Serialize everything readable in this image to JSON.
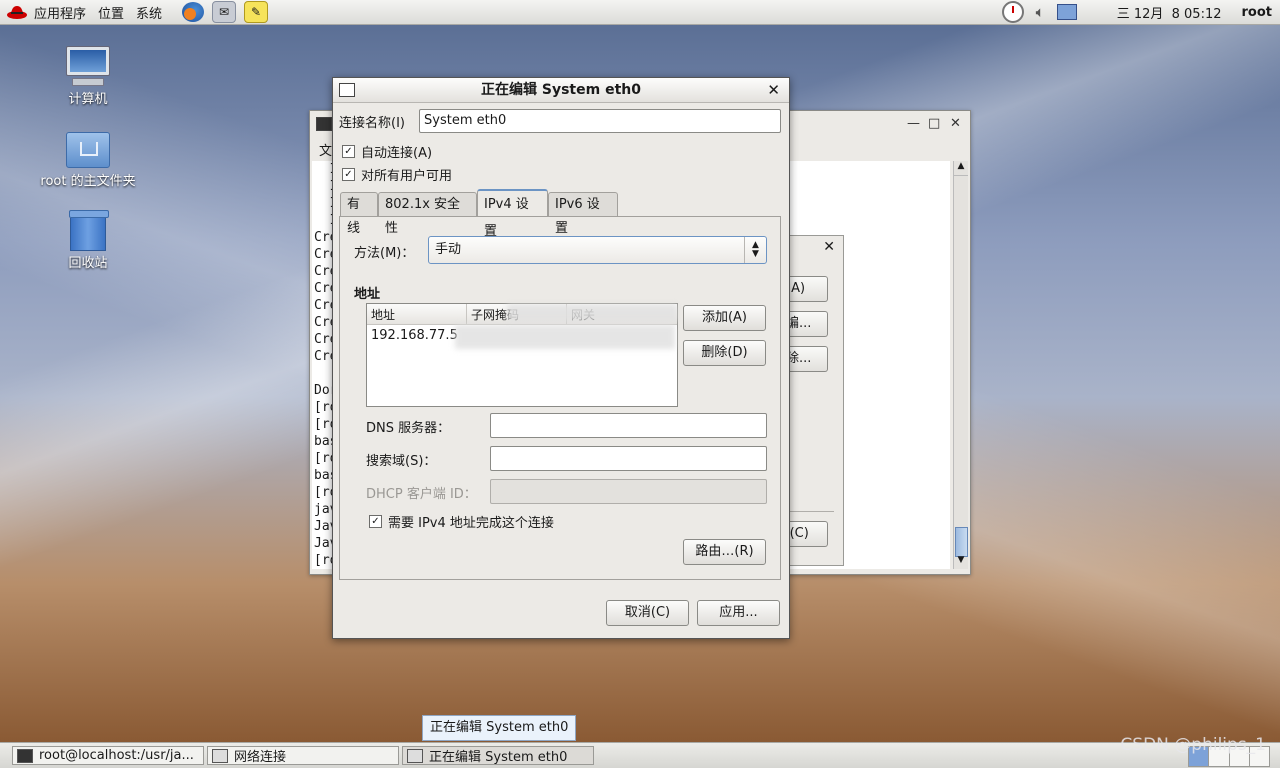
{
  "top_panel": {
    "menu_applications": "应用程序",
    "menu_places": "位置",
    "menu_system": "系统",
    "clock": "三 12月  8 05:12",
    "user": "root"
  },
  "desktop_icons": {
    "computer": "计算机",
    "home": "root 的主文件夹",
    "trash": "回收站"
  },
  "terminal": {
    "menu_first": "文",
    "lines": [
      "  I",
      "  I",
      "  I",
      "  I",
      "Cre",
      "Cre",
      "Cre",
      "Cre",
      "Cre",
      "Cre",
      "Cre",
      "Cre",
      "",
      "Dor",
      "[ro",
      "[ro",
      "bas",
      "[ro",
      "bas",
      "[ro",
      "jav",
      "Jav",
      "Jav",
      "[ro"
    ]
  },
  "netconn": {
    "add_button": "(A)",
    "edit_button": "编...",
    "delete_button": "除...",
    "close_button": "l(C)"
  },
  "dialog": {
    "title": "正在编辑 System eth0",
    "connection_name_label": "连接名称(I)",
    "connection_name_value": "System eth0",
    "auto_connect_label": "自动连接(A)",
    "all_users_label": "对所有用户可用",
    "tabs": [
      "有线",
      "802.1x 安全性",
      "IPv4 设置",
      "IPv6 设置"
    ],
    "method_label": "方法(M)：",
    "method_value": "手动",
    "address_section": "地址",
    "table_headers": [
      "地址",
      "子网掩码",
      "网关"
    ],
    "address_row": "192.168.77.5",
    "add_button": "添加(A)",
    "delete_button": "删除(D)",
    "dns_label": "DNS 服务器：",
    "search_domain_label": "搜索域(S)：",
    "dhcp_client_label": "DHCP 客户端 ID：",
    "require_ipv4_label": "需要 IPv4 地址完成这个连接",
    "routes_button": "路由…(R)",
    "cancel_button": "取消(C)",
    "apply_button": "应用..."
  },
  "taskbar": {
    "task_terminal": "root@localhost:/usr/ja...",
    "task_network": "网络连接",
    "task_editing": "正在编辑 System eth0"
  },
  "tooltip": "正在编辑 System eth0",
  "watermark": "CSDN @philips_1"
}
